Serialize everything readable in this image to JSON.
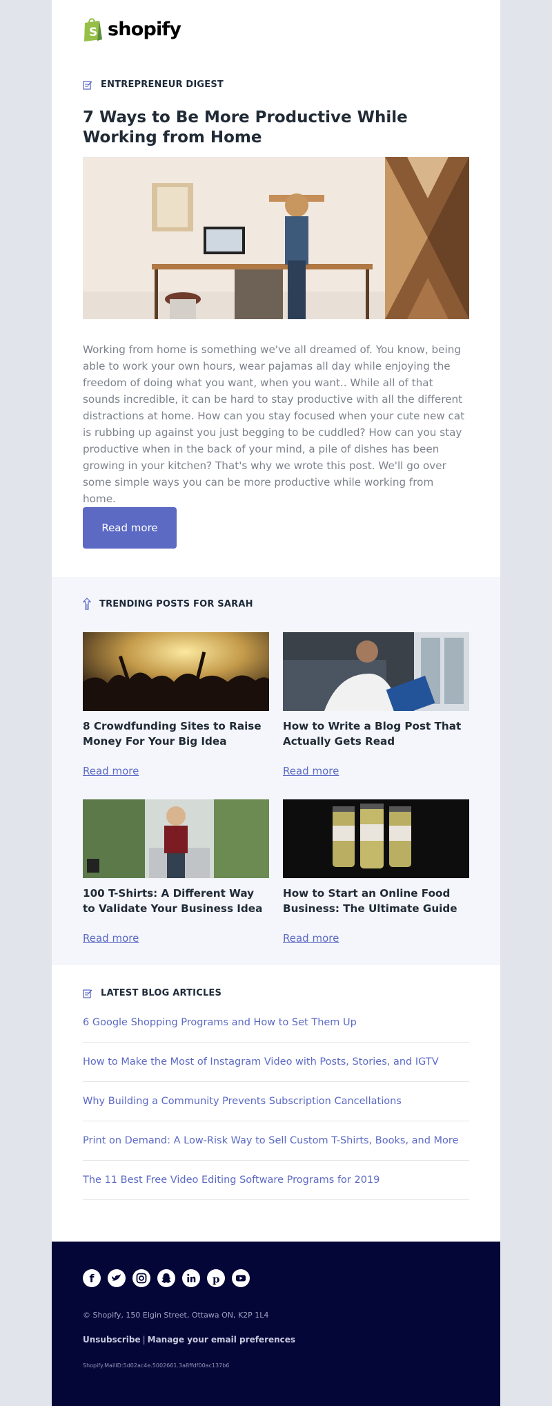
{
  "brand": {
    "name": "shopify",
    "green": "#95bf47",
    "accent": "#5c6ac4",
    "footer_bg": "#050638"
  },
  "hero": {
    "section_icon": "edit-note-icon",
    "section_label": "ENTREPRENEUR DIGEST",
    "title": "7 Ways to Be More Productive While Working from Home",
    "body": "Working from home is something we've all dreamed of. You know, being able to work your own hours, wear pajamas all day while enjoying the freedom of doing what you want, when you want.. While all of that sounds incredible, it can be hard to stay productive with all the different distractions at home. How can you stay focused when your cute new cat is rubbing up against you just begging to be cuddled? How can you stay productive when in the back of your mind, a pile of dishes has been growing in your kitchen? That's why we wrote this post. We'll go over some simple ways you can be more productive while working from home.",
    "button_label": "Read more"
  },
  "trending": {
    "section_icon": "trending-arrow-icon",
    "section_label": "TRENDING POSTS FOR SARAH",
    "posts": [
      {
        "title": "8 Crowdfunding Sites to Raise Money For Your Big Idea",
        "link": "Read more"
      },
      {
        "title": "How to Write a Blog Post That Actually Gets Read",
        "link": "Read more"
      },
      {
        "title": "100 T-Shirts: A Different Way to Validate Your Business Idea",
        "link": "Read more"
      },
      {
        "title": "How to Start an Online Food Business: The Ultimate Guide",
        "link": "Read more"
      }
    ]
  },
  "latest": {
    "section_icon": "edit-note-icon",
    "section_label": "LATEST BLOG ARTICLES",
    "articles": [
      "6 Google Shopping Programs and How to Set Them Up",
      "How to Make the Most of Instagram Video with Posts, Stories, and IGTV",
      "Why Building a Community Prevents Subscription Cancellations",
      "Print on Demand: A Low-Risk Way to Sell Custom T-Shirts, Books, and More",
      "The 11 Best Free Video Editing Software Programs for 2019"
    ]
  },
  "footer": {
    "social": [
      "facebook-icon",
      "twitter-icon",
      "instagram-icon",
      "snapchat-icon",
      "linkedin-icon",
      "pinterest-icon",
      "youtube-icon"
    ],
    "address": "© Shopify,  150 Elgin Street, Ottawa ON, K2P 1L4",
    "unsubscribe": "Unsubscribe",
    "separator": "|",
    "preferences": "Manage your email preferences",
    "mail_id": "Shopify.MailID:5d02ac4e.5002661.3a8ffdf00ac137b6"
  }
}
